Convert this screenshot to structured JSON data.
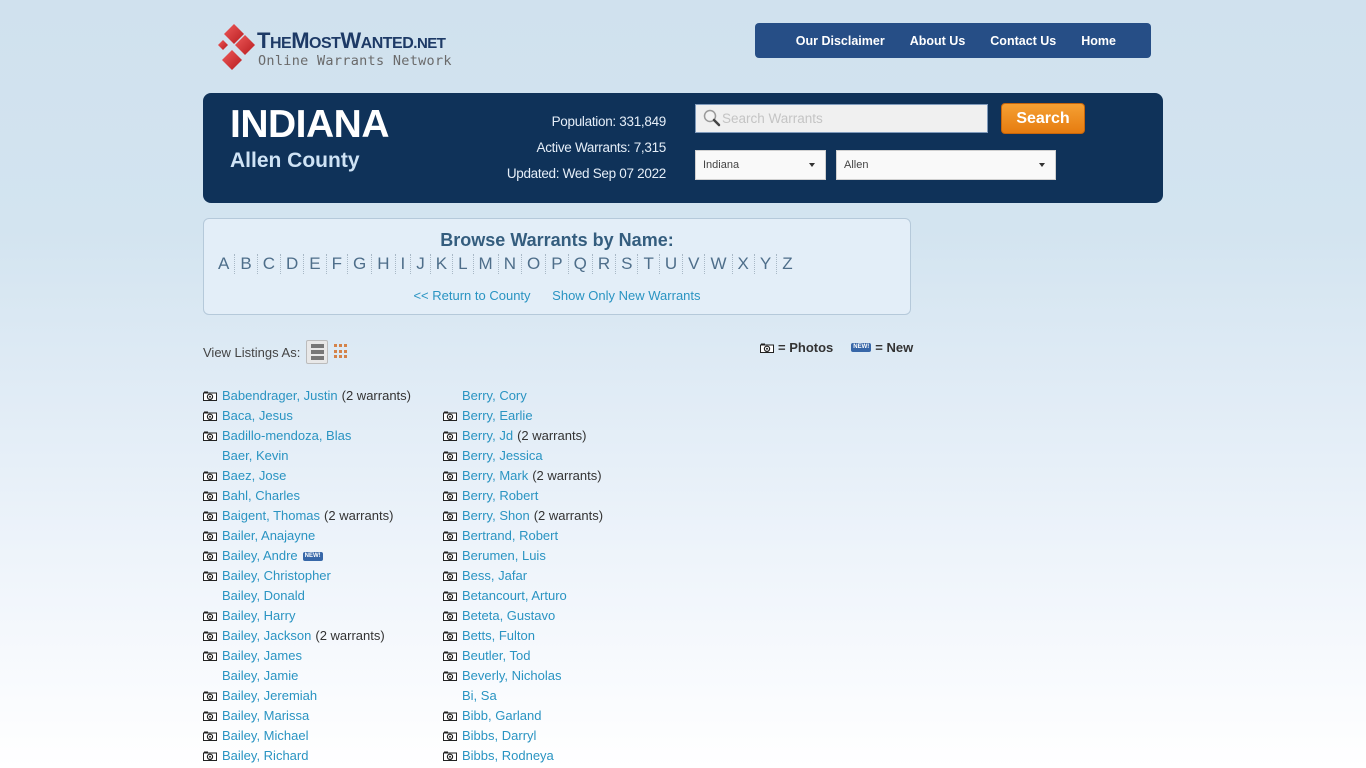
{
  "logo": {
    "title_part1": "The",
    "title_part2": "Most",
    "title_part3": "Wanted",
    "title_part4": ".net",
    "subtitle": "Online Warrants Network",
    "brand_color": "#d42a2f"
  },
  "nav": {
    "items": [
      {
        "label": "Our Disclaimer"
      },
      {
        "label": "About Us"
      },
      {
        "label": "Contact Us"
      },
      {
        "label": "Home"
      }
    ]
  },
  "header": {
    "state": "INDIANA",
    "county": "Allen County",
    "population": "Population: 331,849",
    "active_warrants": "Active Warrants: 7,315",
    "updated": "Updated: Wed Sep 07 2022",
    "search_placeholder": "Search Warrants",
    "search_value": "",
    "search_button": "Search",
    "state_select": "Indiana",
    "county_select": "Allen"
  },
  "browse": {
    "title": "Browse Warrants by Name:",
    "letters": [
      "A",
      "B",
      "C",
      "D",
      "E",
      "F",
      "G",
      "H",
      "I",
      "J",
      "K",
      "L",
      "M",
      "N",
      "O",
      "P",
      "Q",
      "R",
      "S",
      "T",
      "U",
      "V",
      "W",
      "X",
      "Y",
      "Z"
    ],
    "return_link": "<< Return to County",
    "new_link": "Show Only New Warrants"
  },
  "view": {
    "label": "View Listings As:"
  },
  "legend": {
    "photos": "= Photos",
    "new": "= New",
    "new_badge": "NEW!"
  },
  "listings": {
    "column1": [
      {
        "name": "Babendrager, Justin",
        "photo": true,
        "count": "(2 warrants)",
        "new": false
      },
      {
        "name": "Baca, Jesus",
        "photo": true,
        "count": "",
        "new": false
      },
      {
        "name": "Badillo-mendoza, Blas",
        "photo": true,
        "count": "",
        "new": false
      },
      {
        "name": "Baer, Kevin",
        "photo": false,
        "count": "",
        "new": false
      },
      {
        "name": "Baez, Jose",
        "photo": true,
        "count": "",
        "new": false
      },
      {
        "name": "Bahl, Charles",
        "photo": true,
        "count": "",
        "new": false
      },
      {
        "name": "Baigent, Thomas",
        "photo": true,
        "count": "(2 warrants)",
        "new": false
      },
      {
        "name": "Bailer, Anajayne",
        "photo": true,
        "count": "",
        "new": false
      },
      {
        "name": "Bailey, Andre",
        "photo": true,
        "count": "",
        "new": true
      },
      {
        "name": "Bailey, Christopher",
        "photo": true,
        "count": "",
        "new": false
      },
      {
        "name": "Bailey, Donald",
        "photo": false,
        "count": "",
        "new": false
      },
      {
        "name": "Bailey, Harry",
        "photo": true,
        "count": "",
        "new": false
      },
      {
        "name": "Bailey, Jackson",
        "photo": true,
        "count": "(2 warrants)",
        "new": false
      },
      {
        "name": "Bailey, James",
        "photo": true,
        "count": "",
        "new": false
      },
      {
        "name": "Bailey, Jamie",
        "photo": false,
        "count": "",
        "new": false
      },
      {
        "name": "Bailey, Jeremiah",
        "photo": true,
        "count": "",
        "new": false
      },
      {
        "name": "Bailey, Marissa",
        "photo": true,
        "count": "",
        "new": false
      },
      {
        "name": "Bailey, Michael",
        "photo": true,
        "count": "",
        "new": false
      },
      {
        "name": "Bailey, Richard",
        "photo": true,
        "count": "",
        "new": false
      }
    ],
    "column2": [
      {
        "name": "Berry, Cory",
        "photo": false,
        "count": "",
        "new": false
      },
      {
        "name": "Berry, Earlie",
        "photo": true,
        "count": "",
        "new": false
      },
      {
        "name": "Berry, Jd",
        "photo": true,
        "count": "(2 warrants)",
        "new": false
      },
      {
        "name": "Berry, Jessica",
        "photo": true,
        "count": "",
        "new": false
      },
      {
        "name": "Berry, Mark",
        "photo": true,
        "count": "(2 warrants)",
        "new": false
      },
      {
        "name": "Berry, Robert",
        "photo": true,
        "count": "",
        "new": false
      },
      {
        "name": "Berry, Shon",
        "photo": true,
        "count": "(2 warrants)",
        "new": false
      },
      {
        "name": "Bertrand, Robert",
        "photo": true,
        "count": "",
        "new": false
      },
      {
        "name": "Berumen, Luis",
        "photo": true,
        "count": "",
        "new": false
      },
      {
        "name": "Bess, Jafar",
        "photo": true,
        "count": "",
        "new": false
      },
      {
        "name": "Betancourt, Arturo",
        "photo": true,
        "count": "",
        "new": false
      },
      {
        "name": "Beteta, Gustavo",
        "photo": true,
        "count": "",
        "new": false
      },
      {
        "name": "Betts, Fulton",
        "photo": true,
        "count": "",
        "new": false
      },
      {
        "name": "Beutler, Tod",
        "photo": true,
        "count": "",
        "new": false
      },
      {
        "name": "Beverly, Nicholas",
        "photo": true,
        "count": "",
        "new": false
      },
      {
        "name": "Bi, Sa",
        "photo": false,
        "count": "",
        "new": false
      },
      {
        "name": "Bibb, Garland",
        "photo": true,
        "count": "",
        "new": false
      },
      {
        "name": "Bibbs, Darryl",
        "photo": true,
        "count": "",
        "new": false
      },
      {
        "name": "Bibbs, Rodneya",
        "photo": true,
        "count": "",
        "new": false
      }
    ]
  }
}
